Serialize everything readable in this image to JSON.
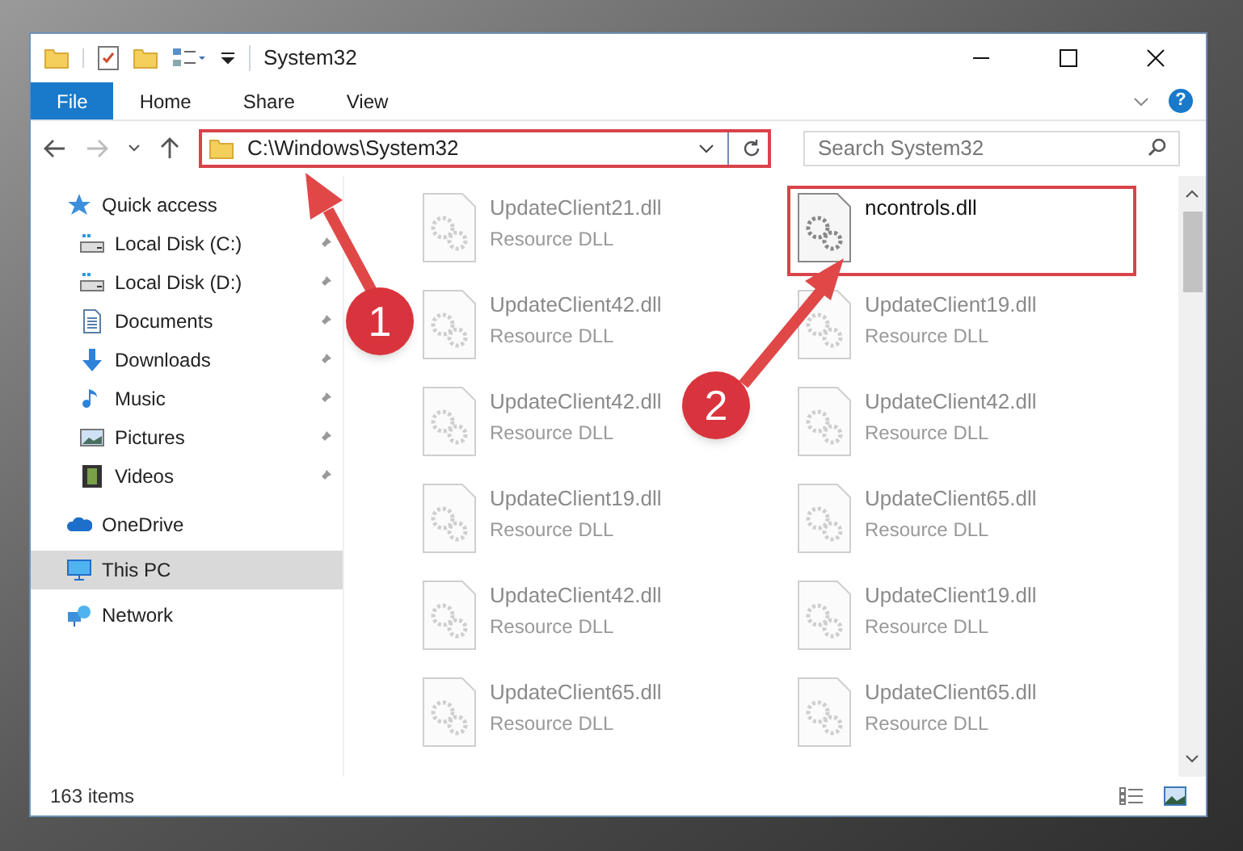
{
  "window": {
    "title": "System32"
  },
  "ribbon_tabs": [
    {
      "label": "File",
      "selected": true
    },
    {
      "label": "Home",
      "selected": false
    },
    {
      "label": "Share",
      "selected": false
    },
    {
      "label": "View",
      "selected": false
    }
  ],
  "address_bar": {
    "path": "C:\\Windows\\System32",
    "highlighted": true
  },
  "search": {
    "placeholder": "Search System32"
  },
  "help_button": {
    "label": "?"
  },
  "navigation": [
    {
      "label": "Quick access",
      "kind": "star",
      "selected": false,
      "children": [
        {
          "label": "Local Disk (C:)",
          "kind": "drive",
          "pinned": true,
          "selected": false
        },
        {
          "label": "Local Disk (D:)",
          "kind": "drive",
          "pinned": true,
          "selected": false
        },
        {
          "label": "Documents",
          "kind": "document",
          "pinned": true,
          "selected": false
        },
        {
          "label": "Downloads",
          "kind": "download",
          "pinned": true,
          "selected": false
        },
        {
          "label": "Music",
          "kind": "music",
          "pinned": true,
          "selected": false
        },
        {
          "label": "Pictures",
          "kind": "picture",
          "pinned": true,
          "selected": false
        },
        {
          "label": "Videos",
          "kind": "video",
          "pinned": true,
          "selected": false
        }
      ]
    },
    {
      "label": "OneDrive",
      "kind": "cloud",
      "selected": false
    },
    {
      "label": "This PC",
      "kind": "pc",
      "selected": true
    },
    {
      "label": "Network",
      "kind": "network",
      "selected": false
    }
  ],
  "files": [
    {
      "name": "UpdateClient21.dll",
      "type": "Resource DLL",
      "highlighted": false
    },
    {
      "name": "ncontrols.dll",
      "highlighted": true
    },
    {
      "name": "UpdateClient42.dll",
      "type": "Resource DLL",
      "highlighted": false
    },
    {
      "name": "UpdateClient19.dll",
      "type": "Resource DLL",
      "highlighted": false
    },
    {
      "name": "UpdateClient42.dll",
      "type": "Resource DLL",
      "highlighted": false
    },
    {
      "name": "UpdateClient42.dll",
      "type": "Resource DLL",
      "highlighted": false
    },
    {
      "name": "UpdateClient19.dll",
      "type": "Resource DLL",
      "highlighted": false
    },
    {
      "name": "UpdateClient65.dll",
      "type": "Resource DLL",
      "highlighted": false
    },
    {
      "name": "UpdateClient42.dll",
      "type": "Resource DLL",
      "highlighted": false
    },
    {
      "name": "UpdateClient19.dll",
      "type": "Resource DLL",
      "highlighted": false
    },
    {
      "name": "UpdateClient65.dll",
      "type": "Resource DLL",
      "highlighted": false
    },
    {
      "name": "UpdateClient65.dll",
      "type": "Resource DLL",
      "highlighted": false
    }
  ],
  "status_bar": {
    "item_count": "163 items"
  },
  "callouts": [
    {
      "label": "1"
    },
    {
      "label": "2"
    }
  ]
}
